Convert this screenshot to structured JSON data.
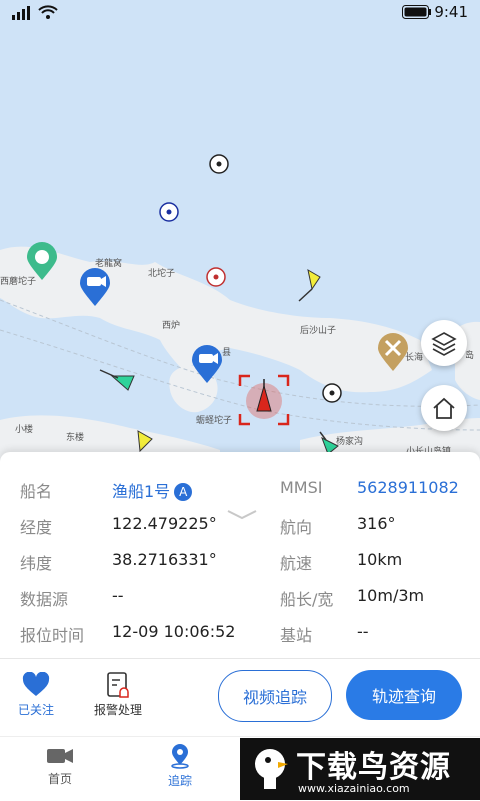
{
  "status": {
    "time": "9:41"
  },
  "map": {
    "places": [
      "西蘑坨子",
      "老龍窝",
      "北坨子",
      "西炉",
      "后沙山子",
      "长海",
      "蛎蛏坨子",
      "小楼",
      "东楼",
      "杨家沟",
      "小长山岛镇",
      "县",
      "岛"
    ]
  },
  "panel": {
    "rows": [
      {
        "label": "船名",
        "value": "渔船1号",
        "badge": "A"
      },
      {
        "label": "经度",
        "value": "122.479225°"
      },
      {
        "label": "纬度",
        "value": "38.2716331°"
      },
      {
        "label": "数据源",
        "value": "--"
      },
      {
        "label": "报位时间",
        "value": "12-09 10:06:52"
      }
    ],
    "right_rows": [
      {
        "label": "MMSI",
        "value": "5628911082"
      },
      {
        "label": "航向",
        "value": "316°"
      },
      {
        "label": "航速",
        "value": "10km"
      },
      {
        "label": "船长/宽",
        "value": "10m/3m"
      },
      {
        "label": "基站",
        "value": "--"
      }
    ],
    "actions": {
      "follow": "已关注",
      "alarm": "报警处理"
    },
    "buttons": {
      "video": "视频追踪",
      "track": "轨迹查询"
    }
  },
  "tabbar": {
    "home": "首页",
    "track": "追踪"
  },
  "watermark": {
    "title": "下载鸟资源",
    "url": "www.xiazainiao.com"
  },
  "colors": {
    "accent": "#2a6fd6",
    "map_water": "#cfe3f7",
    "land": "#eef0f2",
    "target": "#d9261c"
  }
}
